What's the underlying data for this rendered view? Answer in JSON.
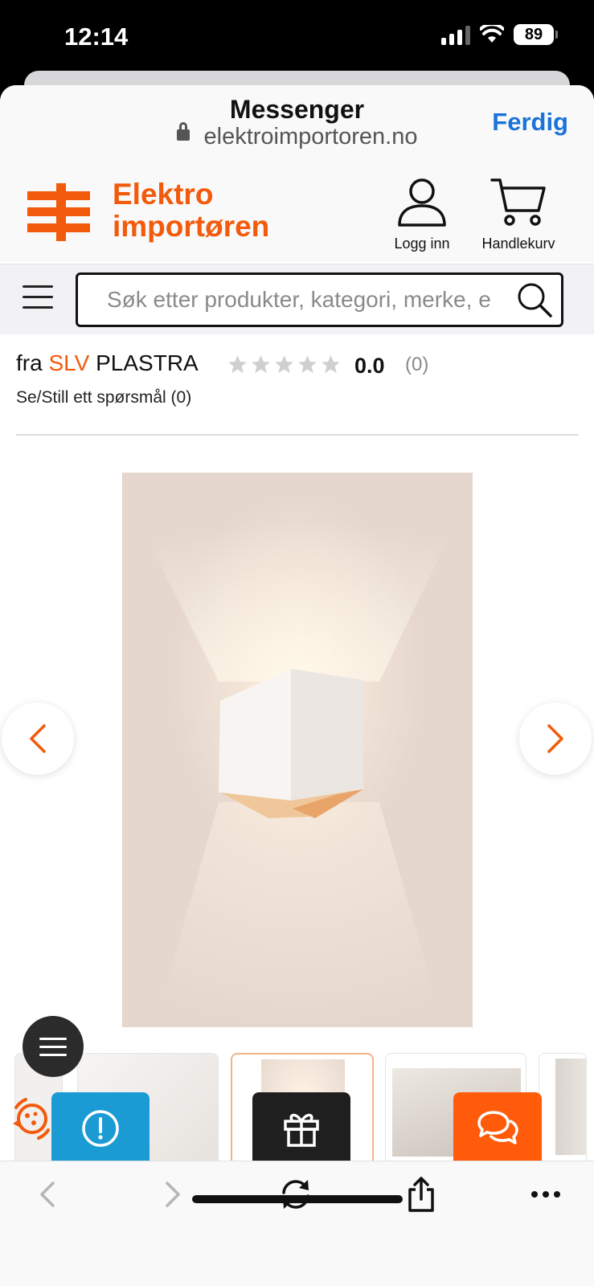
{
  "status_bar": {
    "time": "12:14",
    "battery": "89"
  },
  "browser": {
    "title": "Messenger",
    "url": "elektroimportoren.no",
    "done_label": "Ferdig"
  },
  "site": {
    "logo_line1": "Elektro",
    "logo_line2": "importøren",
    "login_label": "Logg inn",
    "cart_label": "Handlekurv",
    "search_placeholder": "Søk etter produkter, kategori, merke, e"
  },
  "product": {
    "brand_prefix": "fra",
    "brand": "SLV",
    "model": "PLASTRA",
    "rating_value": "0.0",
    "rating_count": "(0)",
    "stars_filled": 0,
    "stars_total": 5,
    "qa_link": "Se/Still ett spørsmål (0)"
  },
  "colors": {
    "accent": "#f25a0c",
    "link_blue": "#1a73d9",
    "feedback_widget": "#1a9bd4",
    "gift_widget": "#1f1f1f",
    "chat_widget": "#ff5b0a"
  },
  "icons": {
    "login": "user-icon",
    "cart": "cart-icon",
    "search": "search-icon",
    "feedback": "alert-circle-icon",
    "gift": "gift-icon",
    "chat": "chat-bubbles-icon",
    "reload": "reload-icon",
    "share": "share-icon",
    "more": "more-icon"
  }
}
